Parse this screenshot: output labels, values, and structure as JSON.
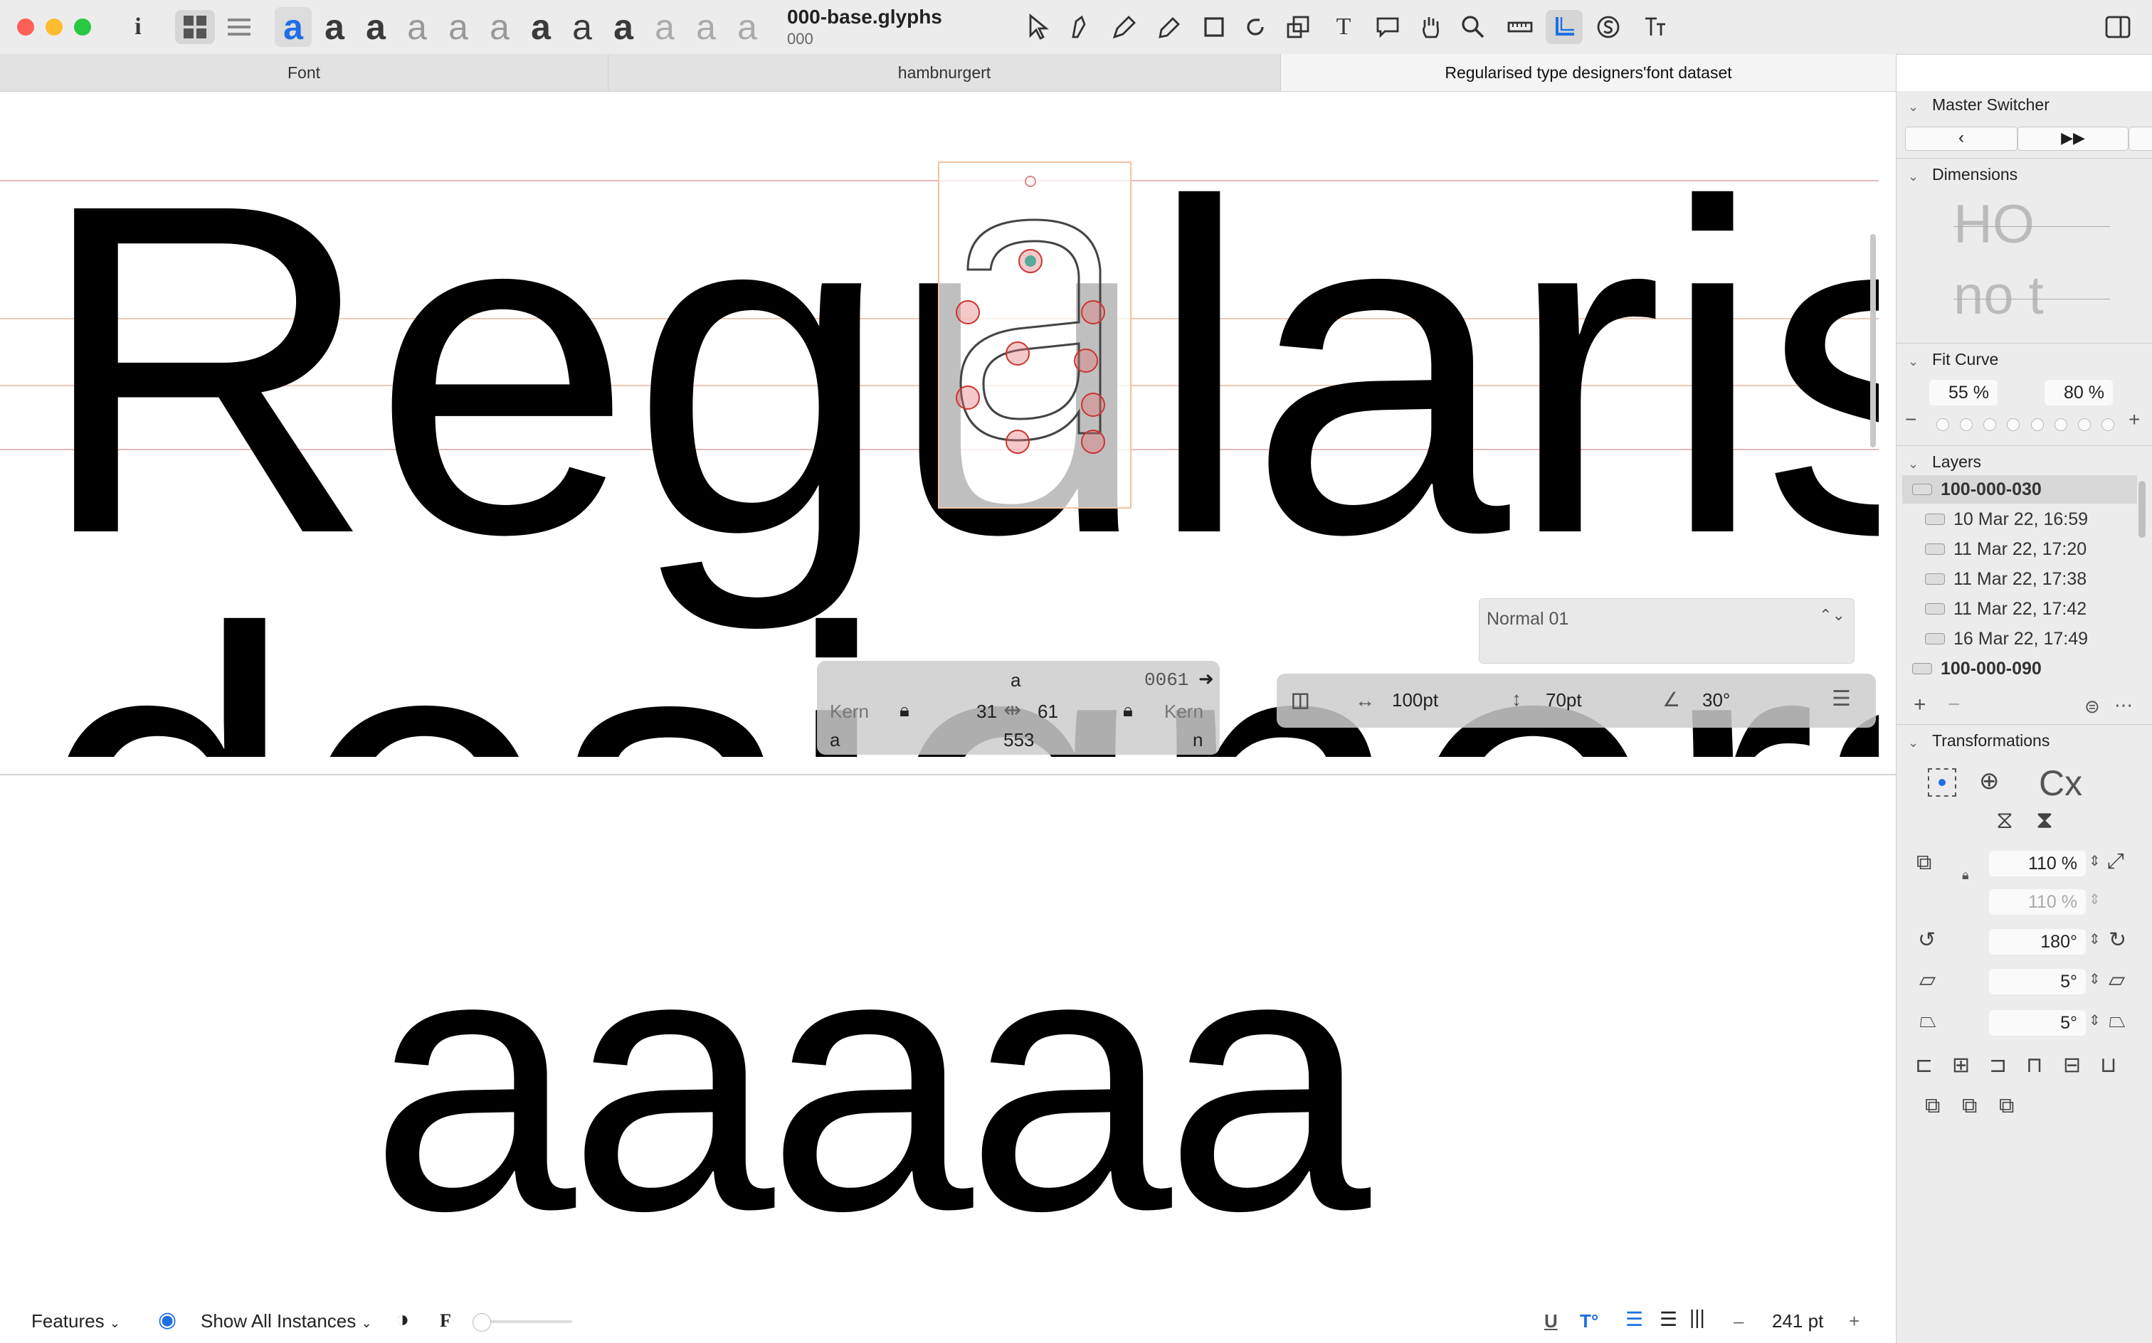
{
  "window": {
    "title": "000-base.glyphs",
    "subtitle": "000",
    "colors": {
      "close": "#fe5f57",
      "minimize": "#febc2e",
      "zoom": "#28c840",
      "accent": "#1f6fe5"
    }
  },
  "toolbar": {
    "info_icon": "i",
    "glyph_styles": [
      "a",
      "a",
      "a",
      "a",
      "a",
      "a",
      "a",
      "a",
      "a",
      "a",
      "a",
      "a"
    ]
  },
  "tabs": [
    "Font",
    "hambnurgert",
    "Regularised type designers'font dataset"
  ],
  "canvas": {
    "line1": "Regularised",
    "line2": "designers'",
    "edit_glyph": "a"
  },
  "glyph_info": {
    "name": "a",
    "unicode": "0061",
    "kern_left_label": "Kern",
    "kern_right_label": "Kern",
    "lsb": "31",
    "rsb": "61",
    "left_group": "a",
    "width": "553",
    "right_group": "n"
  },
  "layer_select": {
    "value": "Normal 01"
  },
  "brush": {
    "width": "100pt",
    "height": "70pt",
    "angle": "30°"
  },
  "preview": {
    "text": "aaaaa"
  },
  "bottombar": {
    "features_label": "Features",
    "show_instances_label": "Show All Instances",
    "f_label": "F",
    "size": "241 pt",
    "minus": "–",
    "plus": "+"
  },
  "sidebar": {
    "master_switcher": {
      "title": "Master Switcher"
    },
    "dimensions": {
      "title": "Dimensions",
      "preview_top": "HO",
      "preview_bottom": "no t"
    },
    "fit_curve": {
      "title": "Fit Curve",
      "low": "55 %",
      "high": "80 %"
    },
    "layers": {
      "title": "Layers",
      "items": [
        {
          "label": "100-000-030",
          "bold": true
        },
        {
          "label": "10 Mar 22, 16:59",
          "bold": false
        },
        {
          "label": "11 Mar 22, 17:20",
          "bold": false
        },
        {
          "label": "11 Mar 22, 17:38",
          "bold": false
        },
        {
          "label": "11 Mar 22, 17:42",
          "bold": false
        },
        {
          "label": "16 Mar 22, 17:49",
          "bold": false
        },
        {
          "label": "100-000-090",
          "bold": true
        }
      ]
    },
    "transformations": {
      "title": "Transformations",
      "cx": "Cx",
      "scale_x": "110 %",
      "scale_y": "110 %",
      "rotate": "180°",
      "slant_h": "5°",
      "slant_v": "5°"
    }
  }
}
